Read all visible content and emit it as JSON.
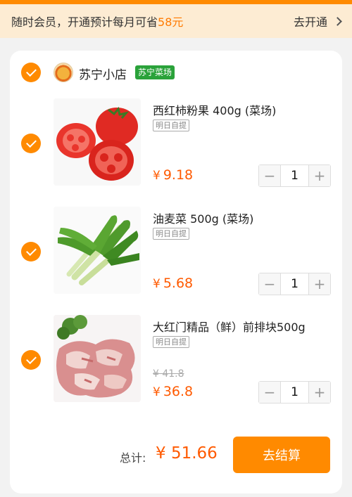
{
  "member_bar": {
    "text_prefix": "随时会员，开通预计每月可省",
    "text_amount": "58元",
    "cta": "去开通"
  },
  "store": {
    "name": "苏宁小店",
    "badge": "苏宁菜场",
    "logo_icon": "mascot-logo-icon"
  },
  "items": [
    {
      "title": "西红柿粉果 400g (菜场)",
      "tag": "明日自提",
      "price_symbol": "¥",
      "price": "9.18",
      "qty": "1",
      "image": "tomato-image"
    },
    {
      "title": "油麦菜 500g (菜场)",
      "tag": "明日自提",
      "price_symbol": "¥",
      "price": "5.68",
      "qty": "1",
      "image": "lettuce-image"
    },
    {
      "title": "大红门精品（鲜）前排块500g",
      "tag": "明日自提",
      "old_price": "¥ 41.8",
      "price_symbol": "¥",
      "price": "36.8",
      "qty": "1",
      "image": "pork-image"
    }
  ],
  "stepper": {
    "minus": "−",
    "plus": "+"
  },
  "footer": {
    "total_label": "总计:",
    "total_value": "¥ 51.66",
    "checkout": "去结算"
  },
  "colors": {
    "accent": "#ff8a00",
    "price": "#ff5a00",
    "badge_green": "#2aa23a",
    "member_bg": "#fdecd3"
  }
}
